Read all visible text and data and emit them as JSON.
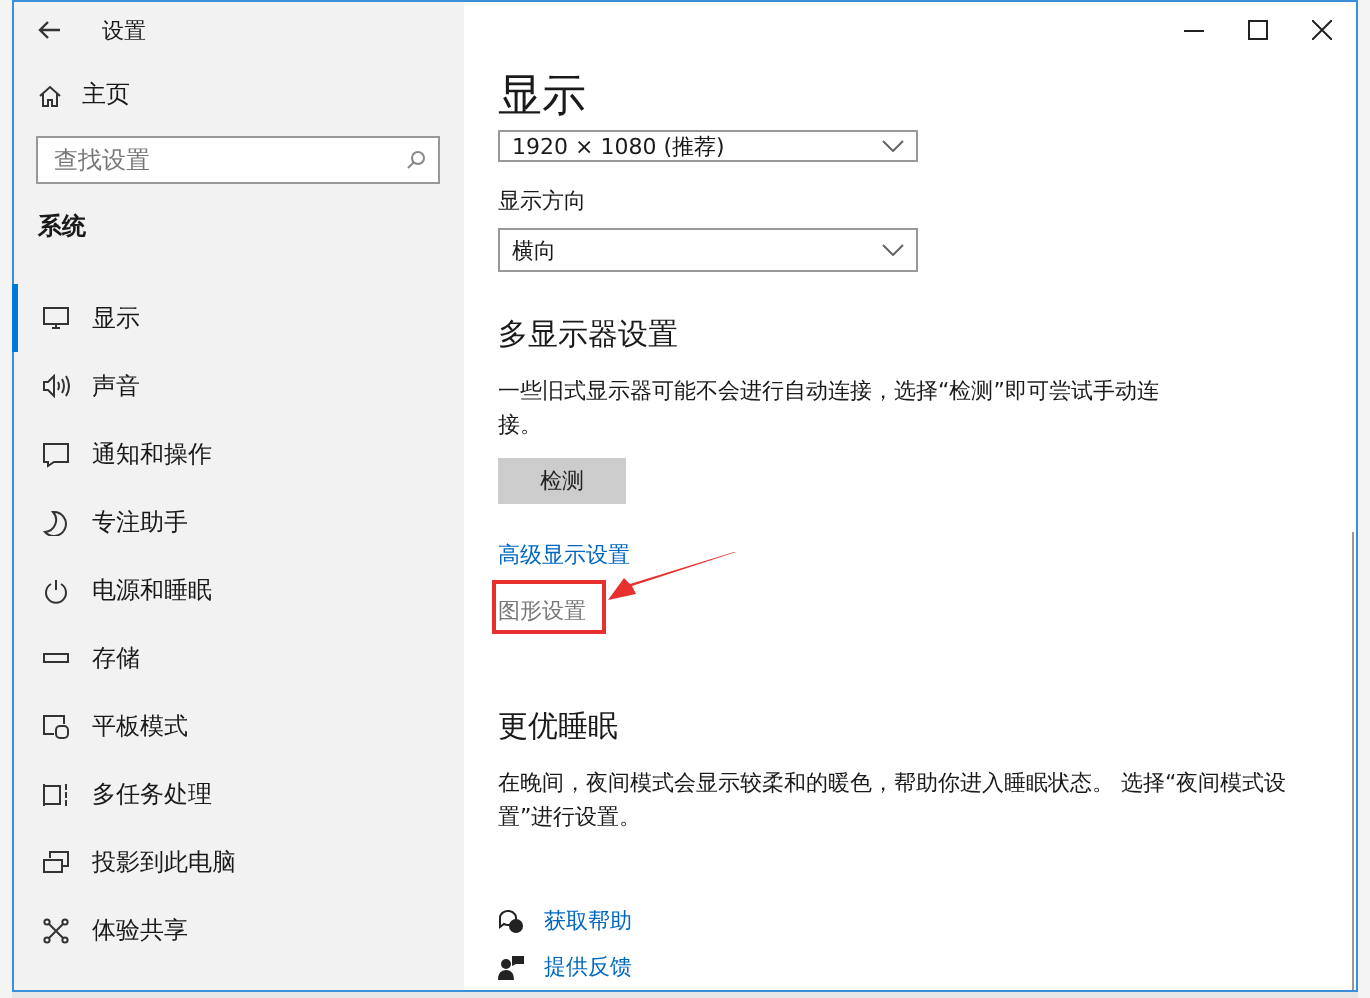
{
  "window": {
    "title": "设置"
  },
  "sidebar": {
    "home": "主页",
    "search": {
      "placeholder": "查找设置"
    },
    "section": "系统",
    "items": [
      {
        "label": "显示",
        "selected": true
      },
      {
        "label": "声音",
        "selected": false
      },
      {
        "label": "通知和操作",
        "selected": false
      },
      {
        "label": "专注助手",
        "selected": false
      },
      {
        "label": "电源和睡眠",
        "selected": false
      },
      {
        "label": "存储",
        "selected": false
      },
      {
        "label": "平板模式",
        "selected": false
      },
      {
        "label": "多任务处理",
        "selected": false
      },
      {
        "label": "投影到此电脑",
        "selected": false
      },
      {
        "label": "体验共享",
        "selected": false
      }
    ]
  },
  "content": {
    "title": "显示",
    "resolution": {
      "value": "1920 × 1080 (推荐)"
    },
    "orientation": {
      "label": "显示方向",
      "value": "横向"
    },
    "multi_display": {
      "heading": "多显示器设置",
      "text": "一些旧式显示器可能不会进行自动连接，选择“检测”即可尝试手动连接。",
      "button": "检测"
    },
    "links": [
      {
        "label": "高级显示设置",
        "enabled": true,
        "callout": false
      },
      {
        "label": "图形设置",
        "enabled": false,
        "callout": true
      }
    ],
    "sleep": {
      "heading": "更优睡眠",
      "text": "在晚间，夜间模式会显示较柔和的暖色，帮助你进入睡眠状态。 选择“夜间模式设置”进行设置。"
    },
    "help": [
      {
        "label": "获取帮助"
      },
      {
        "label": "提供反馈"
      }
    ]
  }
}
